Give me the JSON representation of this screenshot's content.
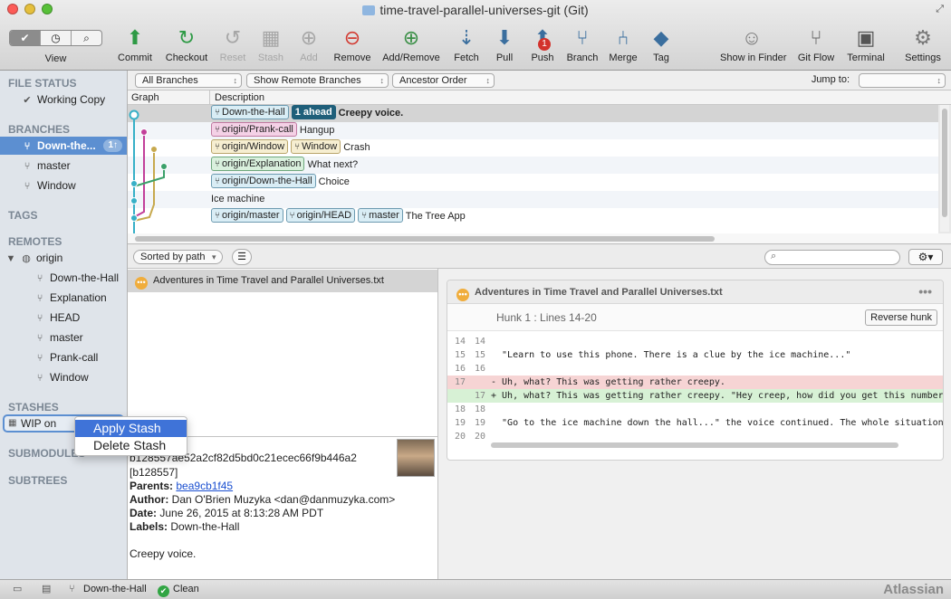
{
  "window": {
    "title": "time-travel-parallel-universes-git (Git)"
  },
  "view": {
    "label": "View",
    "segments": [
      "✔",
      "◷",
      "⌕"
    ]
  },
  "toolbar": {
    "commit": "Commit",
    "checkout": "Checkout",
    "reset": "Reset",
    "stash": "Stash",
    "add": "Add",
    "remove": "Remove",
    "add_remove": "Add/Remove",
    "fetch": "Fetch",
    "pull": "Pull",
    "push": "Push",
    "push_badge": "1",
    "branch": "Branch",
    "merge": "Merge",
    "tag": "Tag",
    "show_in_finder": "Show in Finder",
    "git_flow": "Git Flow",
    "terminal": "Terminal",
    "settings": "Settings"
  },
  "sidebar": {
    "file_status": "FILE STATUS",
    "working_copy": "Working Copy",
    "branches": "BRANCHES",
    "branch_items": [
      "Down-the...",
      "master",
      "Window"
    ],
    "branch_badge": "1↑",
    "tags": "TAGS",
    "remotes": "REMOTES",
    "origin": "origin",
    "remote_items": [
      "Down-the-Hall",
      "Explanation",
      "HEAD",
      "master",
      "Prank-call",
      "Window"
    ],
    "stashes": "STASHES",
    "stash_item": "WIP on",
    "submodules": "SUBMODULES",
    "subtrees": "SUBTREES"
  },
  "context_menu": {
    "apply": "Apply Stash",
    "delete": "Delete Stash"
  },
  "filters": {
    "all_branches": "All Branches",
    "show_remote": "Show Remote Branches",
    "ancestor": "Ancestor Order",
    "jump_to": "Jump to:"
  },
  "log": {
    "col_graph": "Graph",
    "col_desc": "Description",
    "rows": [
      {
        "tags": [
          {
            "text": "Down-the-Hall",
            "style": "plain"
          },
          {
            "text": "1 ahead",
            "style": "dark"
          }
        ],
        "message": "Creepy voice.",
        "bold": true
      },
      {
        "tags": [
          {
            "text": "origin/Prank-call",
            "style": "pink"
          }
        ],
        "message": "Hangup"
      },
      {
        "tags": [
          {
            "text": "origin/Window",
            "style": "yellow"
          },
          {
            "text": "Window",
            "style": "yellow"
          }
        ],
        "message": "Crash"
      },
      {
        "tags": [
          {
            "text": "origin/Explanation",
            "style": "green"
          }
        ],
        "message": "What next?"
      },
      {
        "tags": [
          {
            "text": "origin/Down-the-Hall",
            "style": "plain"
          }
        ],
        "message": "Choice"
      },
      {
        "tags": [],
        "message": "Ice machine"
      },
      {
        "tags": [
          {
            "text": "origin/master",
            "style": "plain"
          },
          {
            "text": "origin/HEAD",
            "style": "plain"
          },
          {
            "text": "master",
            "style": "plain"
          }
        ],
        "message": "The Tree App"
      }
    ]
  },
  "files": {
    "sorted": "Sorted by path",
    "item": "Adventures in Time Travel and Parallel Universes.txt"
  },
  "details": {
    "hash": "b128557ae52a2cf82d5bd0c21ecec66f9b446a2",
    "short": "[b128557]",
    "parents_label": "Parents:",
    "parents": "bea9cb1f45",
    "author_label": "Author:",
    "author": "Dan O'Brien Muzyka <dan@danmuzyka.com>",
    "date_label": "Date:",
    "date": "June 26, 2015 at 8:13:28 AM PDT",
    "labels_label": "Labels:",
    "labels": "Down-the-Hall",
    "message": "Creepy voice."
  },
  "diff": {
    "file": "Adventures in Time Travel and Parallel Universes.txt",
    "hunk": "Hunk 1 : Lines 14-20",
    "reverse": "Reverse hunk",
    "lines": [
      {
        "o": "14",
        "n": "14",
        "t": "",
        "k": "ctx"
      },
      {
        "o": "15",
        "n": "15",
        "t": "  \"Learn to use this phone. There is a clue by the ice machine...\"",
        "k": "ctx"
      },
      {
        "o": "16",
        "n": "16",
        "t": "",
        "k": "ctx"
      },
      {
        "o": "17",
        "n": "",
        "t": "- Uh, what? This was getting rather creepy.",
        "k": "rem"
      },
      {
        "o": "",
        "n": "17",
        "t": "+ Uh, what? This was getting rather creepy. \"Hey creep, how did you get this number",
        "k": "add"
      },
      {
        "o": "18",
        "n": "18",
        "t": "",
        "k": "ctx"
      },
      {
        "o": "19",
        "n": "19",
        "t": "  \"Go to the ice machine down the hall...\" the voice continued. The whole situation",
        "k": "ctx"
      },
      {
        "o": "20",
        "n": "20",
        "t": "",
        "k": "ctx"
      }
    ]
  },
  "status": {
    "branch": "Down-the-Hall",
    "clean": "Clean",
    "brand": "Atlassian"
  }
}
